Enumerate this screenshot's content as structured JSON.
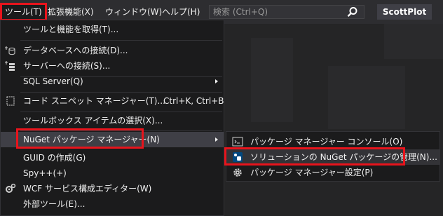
{
  "menubar": {
    "items": [
      {
        "label": "ツール(T)",
        "active": true
      },
      {
        "label": "拡張機能(X)"
      },
      {
        "label": "ウィンドウ(W)"
      },
      {
        "label": "ヘルプ(H)"
      }
    ],
    "search_placeholder": "検索 (Ctrl+Q)",
    "search_icon": "search-icon",
    "user_badge": "ScottPlot"
  },
  "tools_menu": {
    "items": [
      {
        "label": "ツールと機能を取得(T)..."
      },
      {
        "label": "データベースへの接続(D)...",
        "icon": "database-connect-icon"
      },
      {
        "label": "サーバーへの接続(S)...",
        "icon": "server-connect-icon"
      },
      {
        "label": "SQL Server(Q)",
        "submenu": true
      },
      {
        "label": "コード スニペット マネージャー(T)...",
        "shortcut": "Ctrl+K, Ctrl+B",
        "icon": "snippet-icon"
      },
      {
        "label": "ツールボックス アイテムの選択(X)..."
      },
      {
        "label": "NuGet パッケージ マネージャー(N)",
        "submenu": true,
        "highlighted": true
      },
      {
        "label": "GUID の作成(G)"
      },
      {
        "label": "Spy++(+)"
      },
      {
        "label": "WCF サービス構成エディター(W)",
        "icon": "gears-icon"
      },
      {
        "label": "外部ツール(E)..."
      }
    ]
  },
  "nuget_submenu": {
    "items": [
      {
        "label": "パッケージ マネージャー コンソール(O)",
        "icon": "console-icon"
      },
      {
        "label": "ソリューションの NuGet パッケージの管理(N)...",
        "icon": "nuget-package-icon",
        "highlighted": true
      },
      {
        "label": "パッケージ マネージャー設定(P)",
        "icon": "settings-gear-icon"
      }
    ]
  },
  "colors": {
    "background": "#2d2d30",
    "menu_bg": "#1b1b1c",
    "highlight": "#3f3f46",
    "annotation_red": "#e8141c",
    "text": "#f1f1f1"
  }
}
